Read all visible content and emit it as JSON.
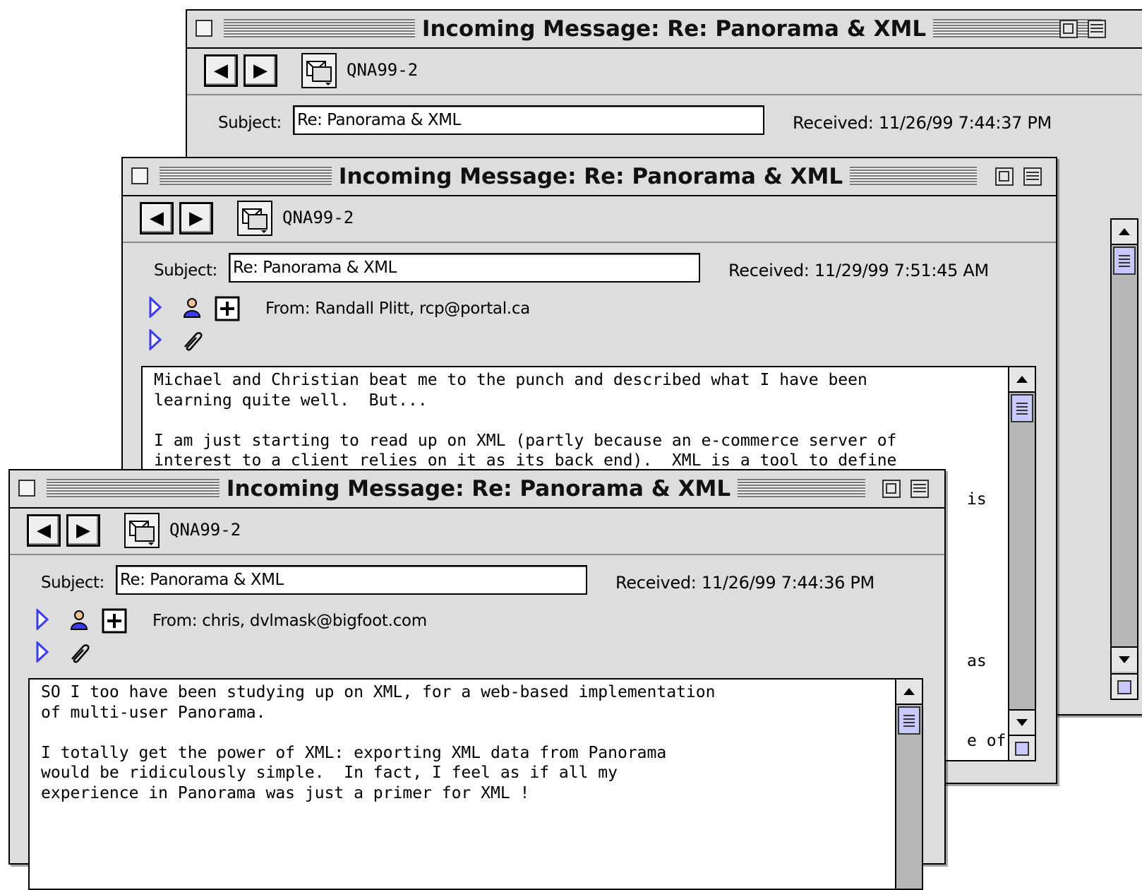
{
  "windows": [
    {
      "title": "Incoming Message: Re: Panorama & XML",
      "mailbox": "QNA99-2",
      "subject_label": "Subject:",
      "subject_value": "Re: Panorama & XML",
      "received": "Received: 11/26/99 7:44:37 PM",
      "from": "",
      "visible_body_fragments": [
        "",
        ""
      ]
    },
    {
      "title": "Incoming Message: Re: Panorama & XML",
      "mailbox": "QNA99-2",
      "subject_label": "Subject:",
      "subject_value": "Re: Panorama & XML",
      "received": "Received: 11/29/99 7:51:45 AM",
      "from": "From: Randall Plitt, rcp@portal.ca",
      "body": "Michael and Christian beat me to the punch and described what I have been\nlearning quite well.  But...\n\nI am just starting to read up on XML (partly because an e-commerce server of\ninterest to a client relies on it as its back end).  XML is a tool to define",
      "visible_body_fragments": [
        "is",
        "as",
        "e of"
      ]
    },
    {
      "title": "Incoming Message: Re: Panorama & XML",
      "mailbox": "QNA99-2",
      "subject_label": "Subject:",
      "subject_value": "Re: Panorama & XML",
      "received": "Received: 11/26/99 7:44:36 PM",
      "from": "From: chris, dvlmask@bigfoot.com",
      "body": "SO I too have been studying up on XML, for a web-based implementation\nof multi-user Panorama.\n\nI totally get the power of XML: exporting XML data from Panorama\nwould be ridiculously simple.  In fact, I feel as if all my\nexperience in Panorama was just a primer for XML !"
    }
  ],
  "icons": {
    "back": "back-arrow-icon",
    "forward": "forward-arrow-icon",
    "mailbox": "mailbox-icon",
    "expand": "disclosure-triangle-icon",
    "person": "person-icon",
    "add": "add-address-icon",
    "attachment": "paperclip-icon"
  },
  "colors": {
    "window_bg": "#dddddd",
    "scroll_thumb": "#c8c8ff",
    "disclosure": "#3a3aff"
  }
}
